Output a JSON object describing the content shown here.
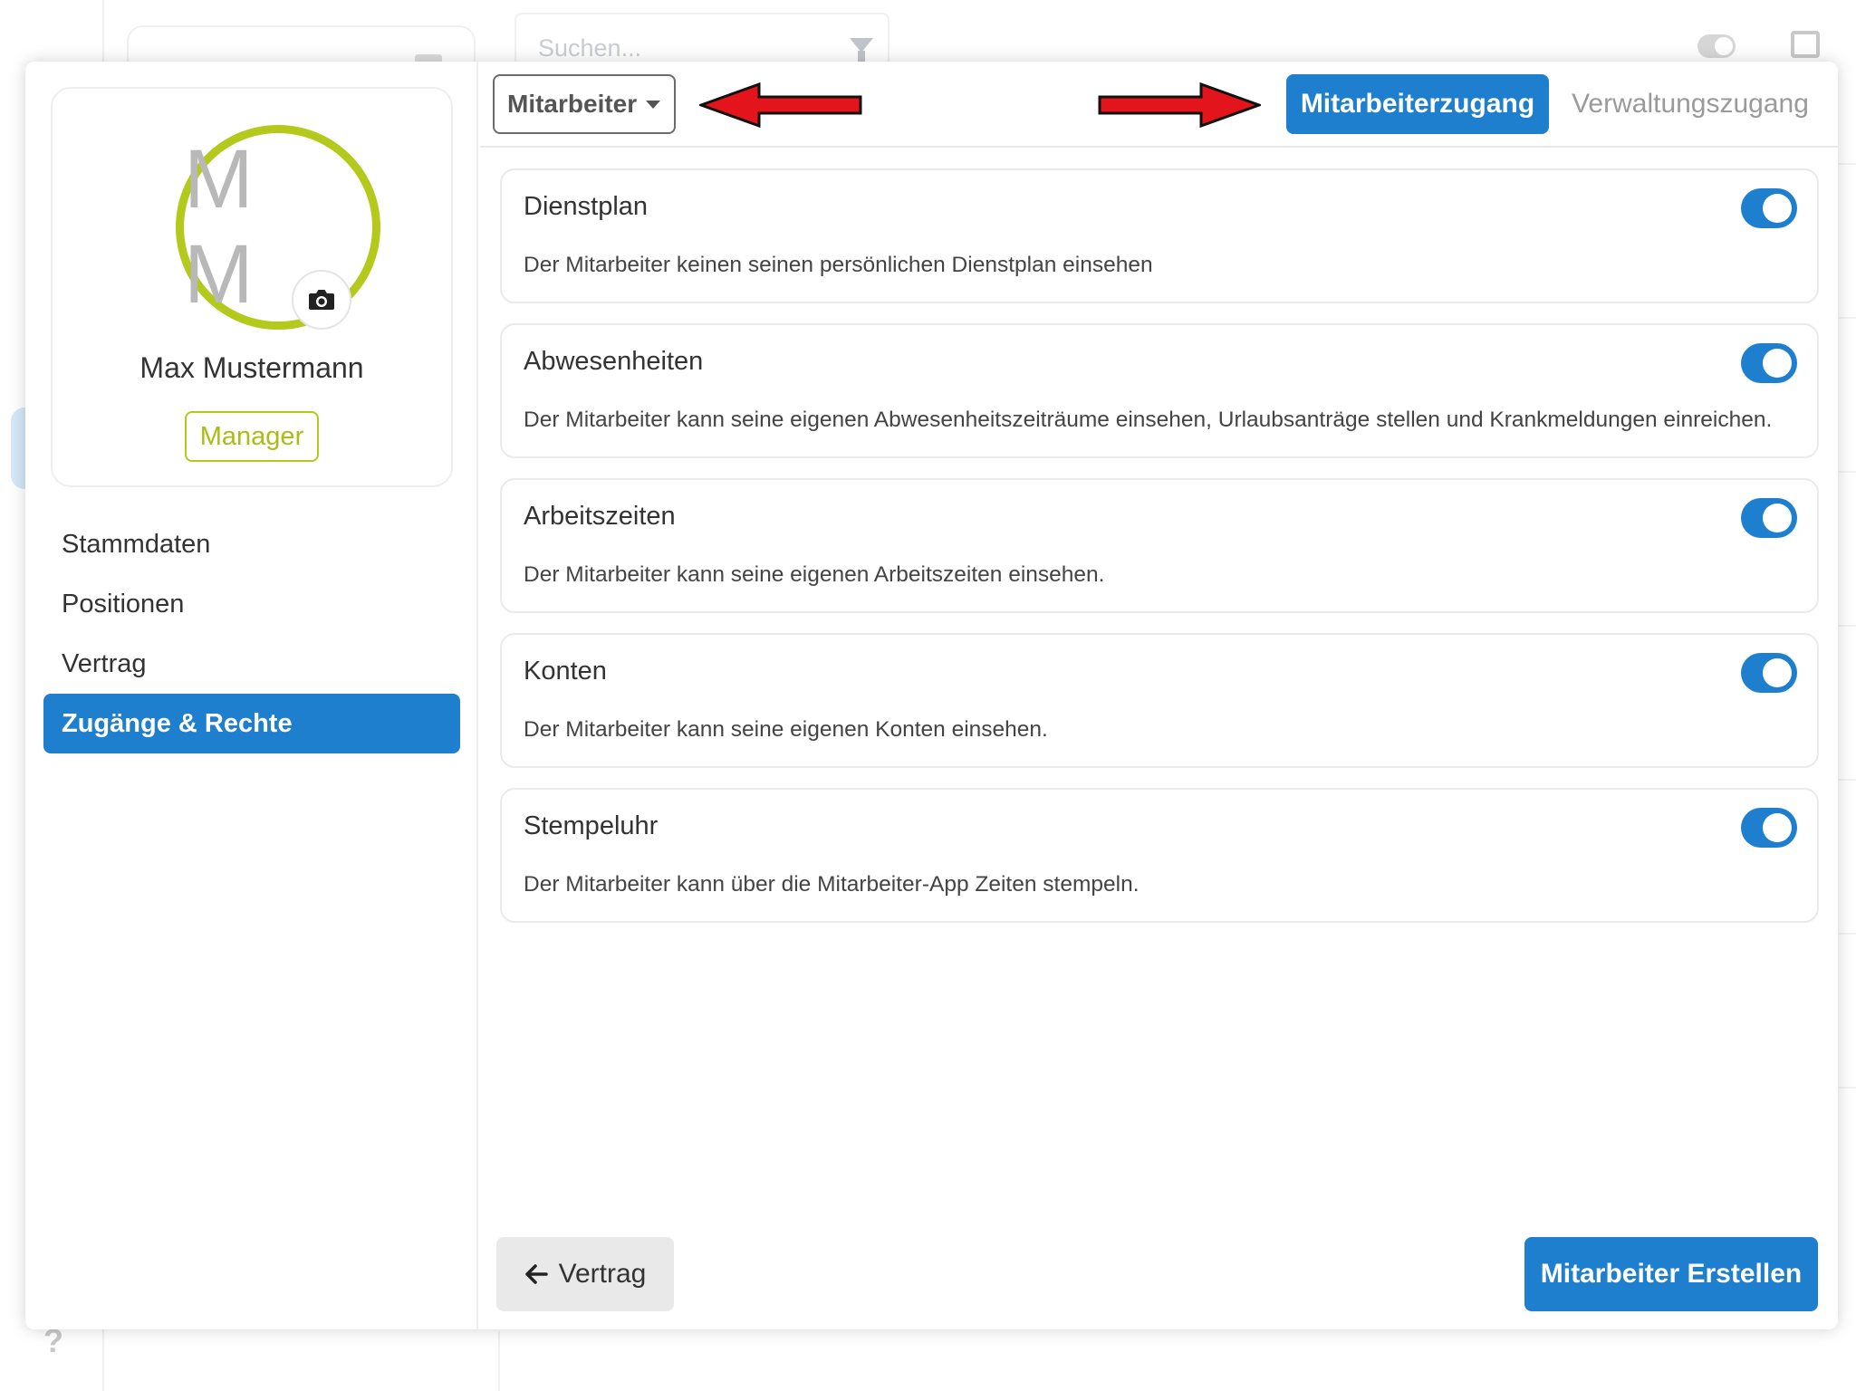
{
  "background": {
    "search_placeholder": "Suchen...",
    "help_label": "?",
    "icons": [
      "filter-icon",
      "toggle-icon",
      "print-icon"
    ]
  },
  "profile": {
    "initials": "M M",
    "name": "Max Mustermann",
    "role": "Manager",
    "avatar_ring_color": "#b3c91c"
  },
  "nav": {
    "items": [
      {
        "label": "Stammdaten",
        "active": false
      },
      {
        "label": "Positionen",
        "active": false
      },
      {
        "label": "Vertrag",
        "active": false
      },
      {
        "label": "Zugänge & Rechte",
        "active": true
      }
    ]
  },
  "topbar": {
    "role_select": "Mitarbeiter",
    "tabs": [
      {
        "label": "Mitarbeiterzugang",
        "active": true
      },
      {
        "label": "Verwaltungszugang",
        "active": false
      }
    ]
  },
  "permissions": [
    {
      "title": "Dienstplan",
      "description": "Der Mitarbeiter keinen seinen persönlichen Dienstplan einsehen",
      "enabled": true
    },
    {
      "title": "Abwesenheiten",
      "description": "Der Mitarbeiter kann seine eigenen Abwesenheitszeiträume einsehen, Urlaubsanträge stellen und Krankmeldungen einreichen.",
      "enabled": true
    },
    {
      "title": "Arbeitszeiten",
      "description": "Der Mitarbeiter kann seine eigenen Arbeitszeiten einsehen.",
      "enabled": true
    },
    {
      "title": "Konten",
      "description": "Der Mitarbeiter kann seine eigenen Konten einsehen.",
      "enabled": true
    },
    {
      "title": "Stempeluhr",
      "description": "Der Mitarbeiter kann über die Mitarbeiter-App Zeiten stempeln.",
      "enabled": true
    }
  ],
  "footer": {
    "back_label": "Vertrag",
    "create_label": "Mitarbeiter Erstellen"
  },
  "colors": {
    "accent": "#1f7fcf",
    "role_green": "#b3c91c",
    "annotation_arrow": "#e3141b"
  }
}
